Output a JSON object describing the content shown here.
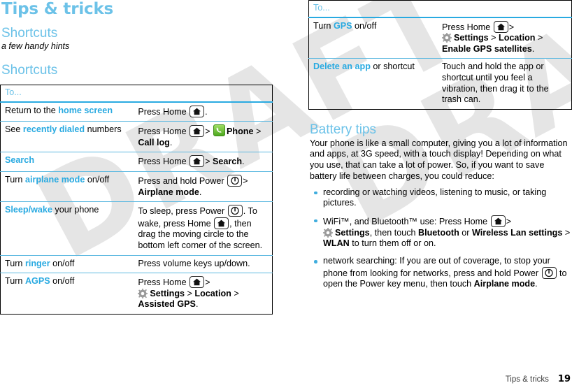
{
  "document": {
    "chapter_title": "Tips & tricks",
    "footer_label": "Tips & tricks",
    "page_number": "19",
    "watermark_text": "DRAFT",
    "accent_color": "#29aae1",
    "heading_color": "#6cc2e8"
  },
  "left_column": {
    "section_heading": "Shortcuts",
    "section_subtitle": "a few handy hints",
    "table_heading": "Shortcuts",
    "table": {
      "header": "To...",
      "rows": [
        {
          "task_plain_1": "Return to the ",
          "task_blue": "home screen",
          "task_plain_2": "",
          "action": "Press Home (home-icon)."
        },
        {
          "task_plain_1": "See ",
          "task_blue": "recently dialed",
          "task_plain_2": " numbers",
          "action": "Press Home (home-icon) > (phone-icon) Phone > Call log."
        },
        {
          "task_plain_1": "",
          "task_blue": "Search",
          "task_plain_2": "",
          "action": "Press Home (home-icon) > Search."
        },
        {
          "task_plain_1": "Turn ",
          "task_blue": "airplane mode",
          "task_plain_2": " on/off",
          "action": "Press and hold Power (power-icon) > Airplane mode."
        },
        {
          "task_plain_1": "",
          "task_blue": "Sleep/wake",
          "task_plain_2": " your phone",
          "action": "To sleep, press Power (power-icon). To wake, press Home (home-icon), then drag the moving circle to the bottom left corner of the screen."
        },
        {
          "task_plain_1": "Turn ",
          "task_blue": "ringer",
          "task_plain_2": " on/off",
          "action": "Press volume keys up/down."
        },
        {
          "task_plain_1": "Turn ",
          "task_blue": "AGPS",
          "task_plain_2": " on/off",
          "action": "Press Home (home-icon) > (gear-icon) Settings > Location > Assisted GPS."
        }
      ]
    }
  },
  "right_column": {
    "table": {
      "header": "To...",
      "rows": [
        {
          "task_plain_1": "Turn ",
          "task_blue": "GPS",
          "task_plain_2": " on/off",
          "action": "Press Home (home-icon) > (gear-icon) Settings > Location > Enable GPS satellites."
        },
        {
          "task_plain_1": "",
          "task_blue": "Delete an app",
          "task_plain_2": " or shortcut",
          "action": "Touch and hold the app or shortcut until you feel a vibration, then drag it to the trash can."
        }
      ]
    },
    "battery": {
      "heading": "Battery tips",
      "paragraph": "Your phone is like a small computer, giving you a lot of information and apps, at 3G speed, with a touch display! Depending on what you use, that can take a lot of power. So, if you want to save battery life between charges, you could reduce:",
      "bullets": [
        {
          "text": "recording or watching videos, listening to music, or taking pictures."
        },
        {
          "text": "WiFi™, and Bluetooth™ use: Press Home (home-icon) > (gear-icon) Settings, then touch Bluetooth or Wireless Lan settings > WLAN to turn them off or on."
        },
        {
          "text": "network searching: If you are out of coverage, to stop your phone from looking for networks, press and hold Power (power-icon) to open the Power key menu, then touch Airplane mode."
        }
      ]
    }
  },
  "labels": {
    "press_home": "Press Home",
    "press_and_hold_power": "Press and hold Power",
    "phone": "Phone",
    "call_log": "Call log",
    "search": "Search",
    "airplane_mode": "Airplane mode",
    "settings": "Settings",
    "location": "Location",
    "assisted_gps": "Assisted GPS",
    "enable_gps_satellites": "Enable GPS satellites",
    "bluetooth": "Bluetooth",
    "wireless_lan_settings": "Wireless Lan settings",
    "wlan": "WLAN",
    "gt": ">"
  },
  "fragments": {
    "r1_action_a": "Press Home",
    "r1_action_b": ".",
    "r2_action_a": "Press Home",
    "r2_action_b": ">",
    "r2_action_c": "Phone",
    "r2_action_d": "> ",
    "r2_action_e": "Call log",
    "r2_action_f": ".",
    "r3_action_a": "Press Home",
    "r3_action_b": "> ",
    "r3_action_c": "Search",
    "r3_action_d": ".",
    "r4_action_a": "Press and hold Power",
    "r4_action_b": "> ",
    "r4_action_c": "Airplane mode",
    "r4_action_d": ".",
    "r5_action_a": "To sleep, press Power",
    "r5_action_b": ". To wake, press Home",
    "r5_action_c": ", then drag the moving circle to the bottom left corner of the screen.",
    "r6_action_a": "Press volume keys up/down.",
    "r7_action_a": "Press Home",
    "r7_action_b": "> ",
    "r7_action_c": "Settings",
    "r7_action_d": " > ",
    "r7_action_e": "Location",
    "r7_action_f": " > ",
    "r7_action_g": "Assisted GPS",
    "r7_action_h": ".",
    "g1_action_a": "Press Home",
    "g1_action_b": "> ",
    "g1_action_c": "Settings",
    "g1_action_d": " > ",
    "g1_action_e": "Location",
    "g1_action_f": " > ",
    "g1_action_g": "Enable GPS satellites",
    "g1_action_h": ".",
    "g2_action_a": "Touch and hold the app or shortcut until you feel a vibration, then drag it to the trash can.",
    "b1_text": "recording or watching videos, listening to music, or taking pictures.",
    "b2_a": "WiFi™, and Bluetooth™ use: Press Home",
    "b2_b": "> ",
    "b2_c": "Settings",
    "b2_d": ", then touch ",
    "b2_e": "Bluetooth",
    "b2_f": " or ",
    "b2_g": "Wireless Lan settings",
    "b2_h": " > ",
    "b2_i": "WLAN",
    "b2_j": " to turn them off or on.",
    "b3_a": "network searching: If you are out of coverage, to stop your phone from looking for networks, press and hold Power",
    "b3_b": " to open the Power key menu, then touch ",
    "b3_c": "Airplane mode",
    "b3_d": "."
  }
}
